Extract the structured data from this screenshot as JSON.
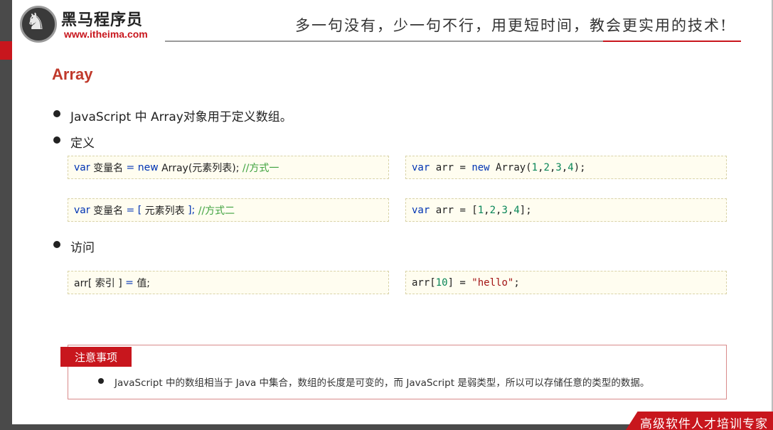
{
  "header": {
    "logo_name": "黑马程序员",
    "logo_url": "www.itheima.com",
    "slogan": "多一句没有，少一句不行，用更短时间，教会更实用的技术!"
  },
  "slide": {
    "title": "Array",
    "bullets": [
      {
        "text": "JavaScript 中 Array对象用于定义数组。"
      },
      {
        "text": "定义"
      },
      {
        "text": "访问"
      }
    ]
  },
  "code": {
    "def1": {
      "kw_var": "var",
      "name": " 变量名 ",
      "eq": "= ",
      "kw_new": "new",
      "rest": " Array(元素列表); ",
      "comment": "//方式一"
    },
    "def2": {
      "kw_var": "var",
      "name": " 变量名 ",
      "eq": "= ",
      "open": "[ ",
      "items": "元素列表 ",
      "close": "]; ",
      "comment": "//方式二"
    },
    "ex1": {
      "kw_var": "var",
      "mid": " arr = ",
      "kw_new": "new",
      "call": " Array(",
      "n1": "1",
      "n2": "2",
      "n3": "3",
      "n4": "4",
      "end": ");"
    },
    "ex2": {
      "kw_var": "var",
      "mid": " arr = [",
      "n1": "1",
      "n2": "2",
      "n3": "3",
      "n4": "4",
      "end": "];"
    },
    "access1": {
      "pre": "arr[ 索引 ] ",
      "eq": "= ",
      "val": "值;"
    },
    "access2": {
      "pre": "arr[",
      "idx": "10",
      "mid": "] = ",
      "str": "\"hello\"",
      "end": ";"
    }
  },
  "note": {
    "label": "注意事项",
    "text": "JavaScript 中的数组相当于 Java 中集合，数组的长度是可变的，而 JavaScript 是弱类型，所以可以存储任意的类型的数据。"
  },
  "footer": {
    "text": "高级软件人才培训专家"
  },
  "colors": {
    "brand_red": "#c8161d",
    "title_red": "#c0392b",
    "keyword_blue": "#0033b3",
    "number_green": "#098658",
    "string_red": "#a31515",
    "comment_green": "#3fa23f",
    "code_bg": "#fffdf0"
  }
}
